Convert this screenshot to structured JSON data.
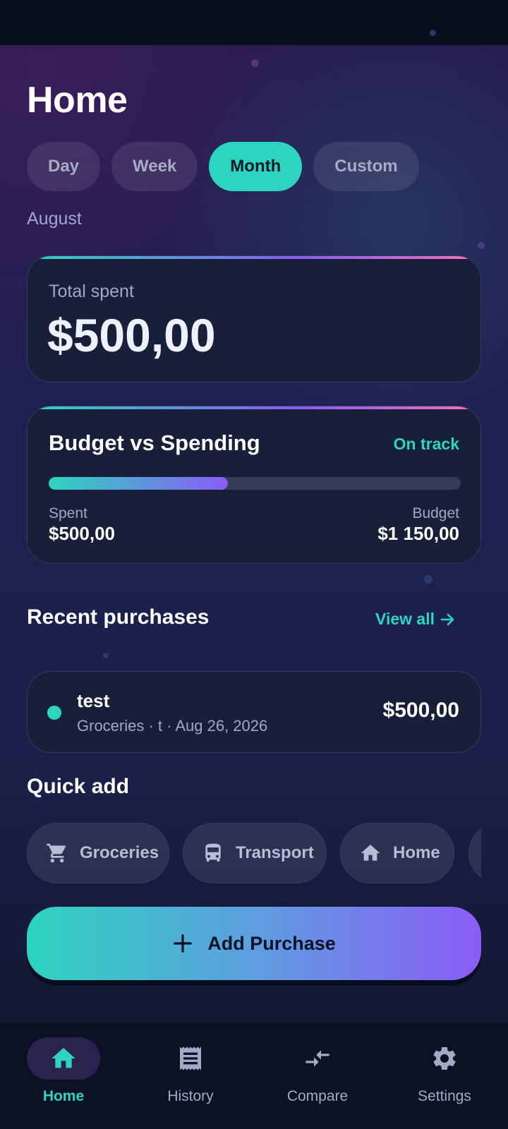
{
  "page": {
    "title": "Home"
  },
  "period_tabs": [
    {
      "label": "Day",
      "active": false
    },
    {
      "label": "Week",
      "active": false
    },
    {
      "label": "Month",
      "active": true
    },
    {
      "label": "Custom",
      "active": false
    }
  ],
  "period": {
    "label": "August"
  },
  "total": {
    "label": "Total spent",
    "value": "$500,00"
  },
  "budget": {
    "title": "Budget vs Spending",
    "status": "On track",
    "progress_fraction": 0.435,
    "spent_label": "Spent",
    "spent_value": "$500,00",
    "budget_label": "Budget",
    "budget_value": "$1 150,00"
  },
  "recent": {
    "title": "Recent purchases",
    "view_all": "View all",
    "items": [
      {
        "name": "test",
        "meta": "Groceries · t · Aug 26, 2026",
        "amount": "$500,00",
        "dot_color": "#2dd4bf"
      }
    ]
  },
  "quick_add": {
    "title": "Quick add",
    "items": [
      {
        "label": "Groceries",
        "icon": "cart-icon"
      },
      {
        "label": "Transport",
        "icon": "bus-icon"
      },
      {
        "label": "Home",
        "icon": "home-icon"
      },
      {
        "label": "",
        "icon": ""
      }
    ]
  },
  "add_button": {
    "label": "Add Purchase",
    "icon": "plus-icon"
  },
  "nav": [
    {
      "label": "Home",
      "icon": "home-icon",
      "active": true
    },
    {
      "label": "History",
      "icon": "receipt-icon",
      "active": false
    },
    {
      "label": "Compare",
      "icon": "compare-arrows-icon",
      "active": false
    },
    {
      "label": "Settings",
      "icon": "gear-icon",
      "active": false
    }
  ],
  "colors": {
    "accent": "#2dd4bf",
    "accent_secondary": "#8b5cf6",
    "card_background": "#181f38",
    "text_muted": "#a4a7c4"
  }
}
